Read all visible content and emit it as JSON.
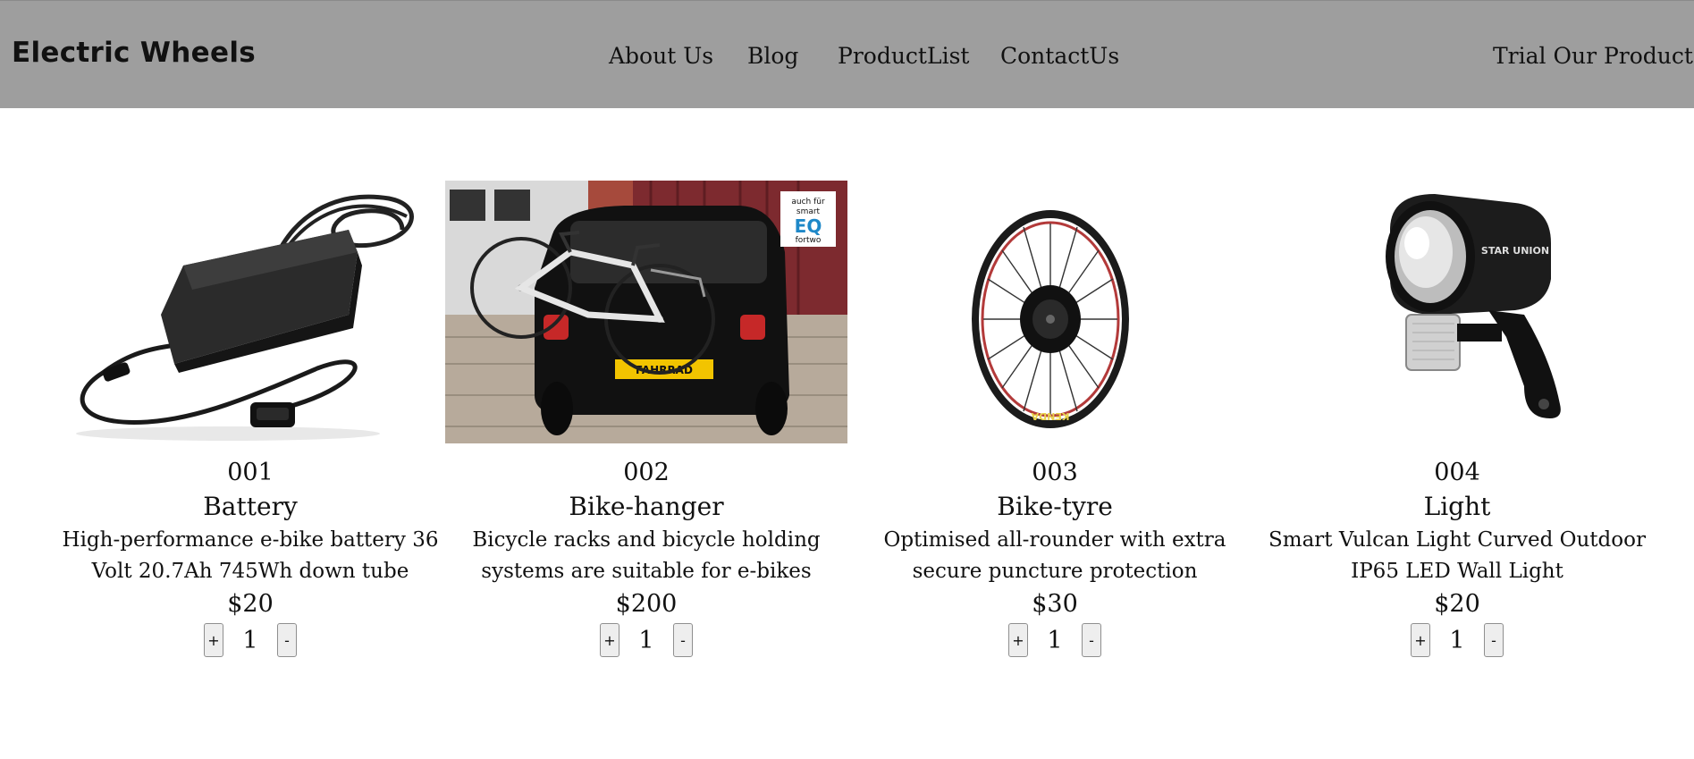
{
  "header": {
    "brand": "Electric Wheels",
    "nav": [
      {
        "label": "About Us"
      },
      {
        "label": "Blog"
      },
      {
        "label": "ProductList"
      },
      {
        "label": "ContactUs"
      }
    ],
    "cta": "Trial Our Product"
  },
  "products": [
    {
      "id": "001",
      "name": "Battery",
      "description": "High-performance e-bike battery 36 Volt 20.7Ah 745Wh down tube",
      "price": "$20",
      "quantity": "1",
      "plus_label": "+",
      "minus_label": "-",
      "image": "ebike-charger-image"
    },
    {
      "id": "002",
      "name": "Bike-hanger",
      "description": "Bicycle racks and bicycle holding systems are suitable for e-bikes",
      "price": "$200",
      "quantity": "1",
      "plus_label": "+",
      "minus_label": "-",
      "image": "bike-rack-on-car-image",
      "image_sticker": {
        "line1": "auch für",
        "line2": "smart",
        "line3": "EQ",
        "line4": "fortwo"
      },
      "license_plate": "FAHRRAD"
    },
    {
      "id": "003",
      "name": "Bike-tyre",
      "description": "Optimised all-rounder with extra secure puncture protection",
      "price": "$30",
      "quantity": "1",
      "plus_label": "+",
      "minus_label": "-",
      "image": "hub-motor-wheel-image",
      "tyre_brand": "KENDA"
    },
    {
      "id": "004",
      "name": "Light",
      "description": "Smart Vulcan Light Curved Outdoor IP65 LED Wall Light",
      "price": "$20",
      "quantity": "1",
      "plus_label": "+",
      "minus_label": "-",
      "image": "bike-headlight-image",
      "lamp_brand": "STAR UNION"
    }
  ],
  "colors": {
    "header_bg": "#9e9e9e",
    "page_bg": "#ffffff",
    "text": "#111111",
    "button_bg": "#eeeeee"
  }
}
